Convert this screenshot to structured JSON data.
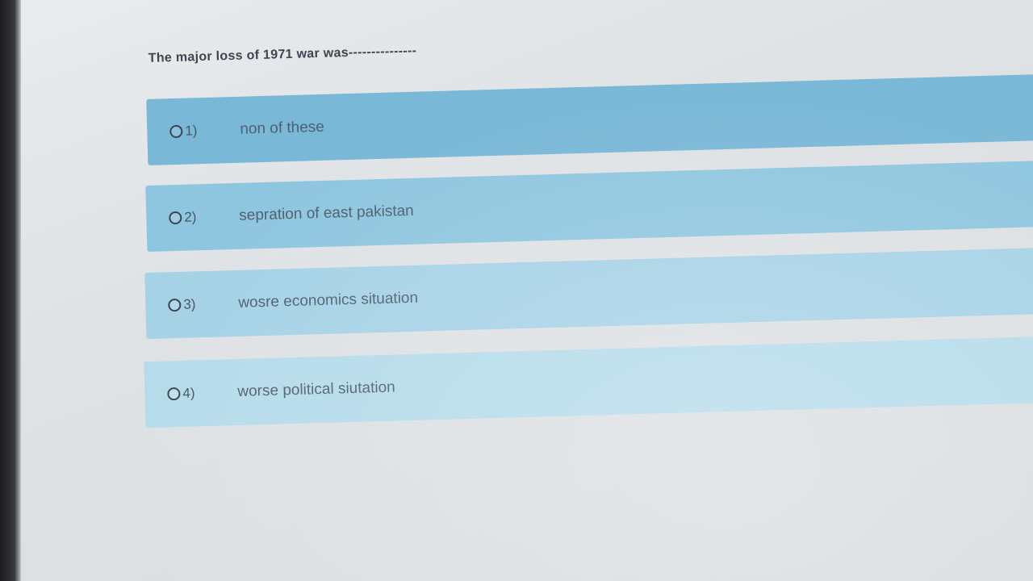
{
  "question": {
    "text": "The major loss of 1971 war was---------------"
  },
  "options": [
    {
      "number": "1)",
      "label": "non of these"
    },
    {
      "number": "2)",
      "label": "sepration of east pakistan"
    },
    {
      "number": "3)",
      "label": "wosre economics situation"
    },
    {
      "number": "4)",
      "label": "worse political siutation"
    }
  ],
  "colors": {
    "option_bg": [
      "#79b8d6",
      "#8fc6df",
      "#a6d2e6",
      "#b5dbea"
    ],
    "question_text": "#3e4550",
    "option_text": "#4f6070"
  }
}
